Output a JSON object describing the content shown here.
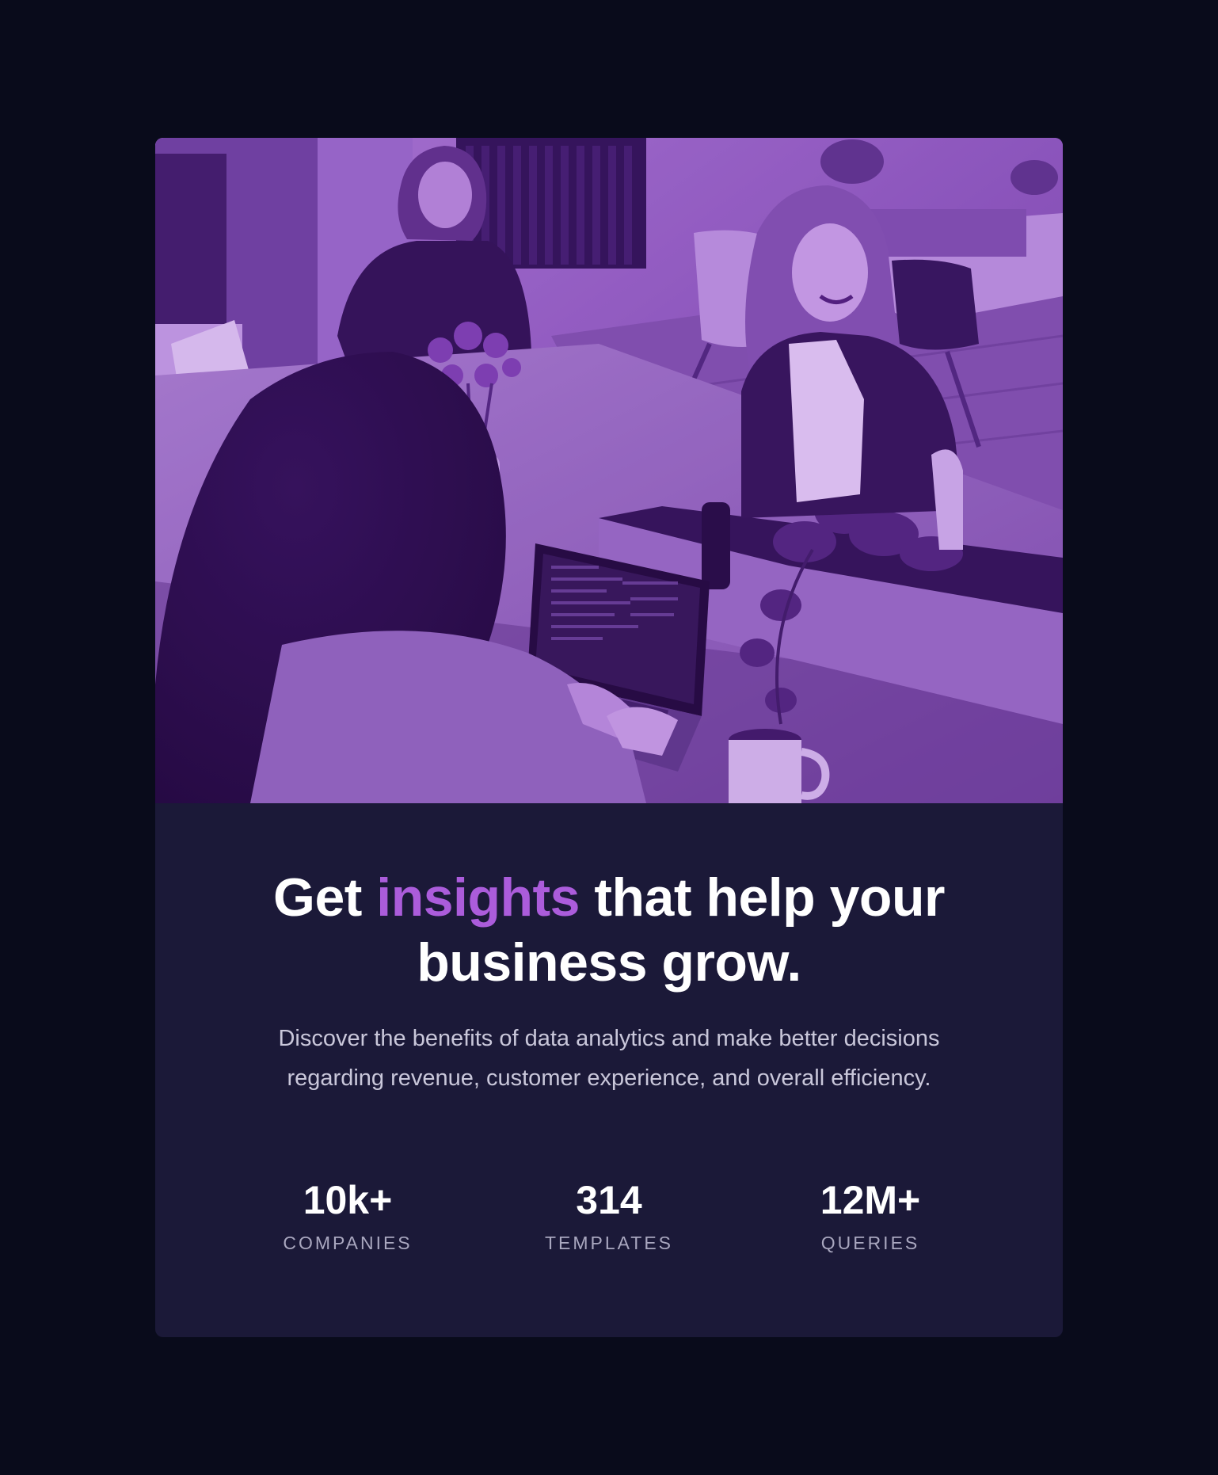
{
  "hero": {
    "alt": "People working at a shared office table"
  },
  "headline": {
    "before": "Get ",
    "accent": "insights",
    "after": " that help your business grow."
  },
  "lead": "Discover the benefits of data analytics and make better decisions regarding revenue, customer experience, and overall efficiency.",
  "stats": [
    {
      "value": "10k+",
      "label": "COMPANIES"
    },
    {
      "value": "314",
      "label": "TEMPLATES"
    },
    {
      "value": "12M+",
      "label": "QUERIES"
    }
  ],
  "colors": {
    "page_background": "#090b1b",
    "card_background": "#1b1938",
    "accent": "#ab5cdb",
    "heading": "#ffffff",
    "body_text": "#c9c7da",
    "stat_label": "#a9a7bf"
  }
}
